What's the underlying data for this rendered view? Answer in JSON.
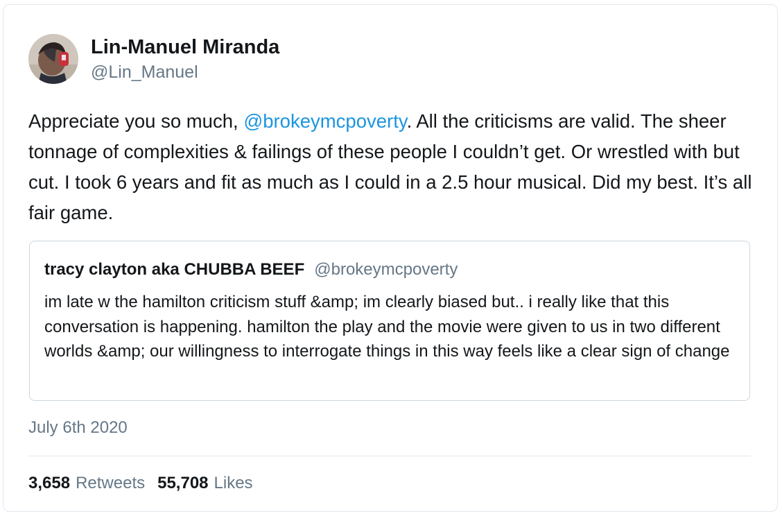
{
  "tweet": {
    "author": {
      "display_name": "Lin-Manuel Miranda",
      "handle": "@Lin_Manuel",
      "avatar_icon": "profile-photo"
    },
    "text_segments": {
      "before": "Appreciate you so much, ",
      "mention": "@brokeymcpoverty",
      "after": ". All the criticisms are valid. The sheer tonnage of complexities & failings of these people I couldn’t get. Or wrestled with but cut. I took 6 years and fit as much as I could in a 2.5 hour musical. Did my best. It’s all fair game."
    },
    "quoted": {
      "name": "tracy clayton aka CHUBBA BEEF",
      "handle": "@brokeymcpoverty",
      "text": "im late w the hamilton criticism stuff &amp; im clearly biased but.. i really like that this conversation is happening. hamilton the play and the movie were given to us in two different worlds &amp; our willingness to interrogate things in this way feels like a clear sign of change"
    },
    "date": "July 6th 2020",
    "stats": {
      "retweets_count": "3,658",
      "retweets_label": "Retweets",
      "likes_count": "55,708",
      "likes_label": "Likes"
    }
  },
  "colors": {
    "mention": "#1b95e0",
    "secondary_text": "#657786",
    "primary_text": "#14171a",
    "border": "#e1e8ed"
  }
}
